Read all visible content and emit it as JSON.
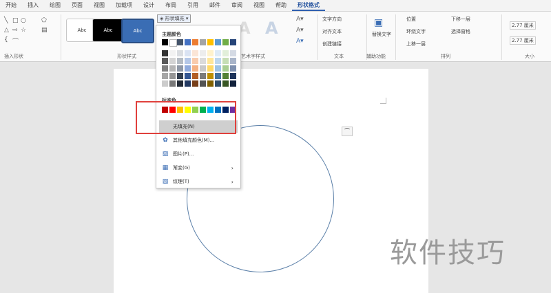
{
  "tabs": [
    "开始",
    "插入",
    "绘图",
    "页面",
    "视图",
    "加载项",
    "设计",
    "布局",
    "引用",
    "邮件",
    "审阅",
    "视图",
    "帮助",
    "形状格式"
  ],
  "active_tab": "形状格式",
  "ribbon": {
    "groups": [
      "插入形状",
      "形状样式",
      "艺术字样式",
      "文本",
      "辅助功能",
      "排列",
      "大小"
    ],
    "style_labels": [
      "Abc",
      "Abc",
      "Abc"
    ],
    "fill_button": "形状填充",
    "text_buttons": [
      "文字方向",
      "对齐文本",
      "创建链接"
    ],
    "alt_text": "替换文字",
    "arrange_buttons": [
      "位置",
      "环绕文字",
      "上移一层",
      "下移一层",
      "选择窗格"
    ],
    "size": {
      "height": "2.77 厘米",
      "width": "2.77 厘米"
    }
  },
  "menu": {
    "theme_colors_label": "主题颜色",
    "standard_colors_label": "标准色",
    "items": [
      {
        "label": "无填充(N)",
        "icon": "no-fill-icon",
        "has_arrow": false
      },
      {
        "label": "其他填充颜色(M)...",
        "icon": "palette-icon",
        "has_arrow": false
      },
      {
        "label": "图片(P)...",
        "icon": "picture-icon",
        "has_arrow": false
      },
      {
        "label": "渐变(G)",
        "icon": "gradient-icon",
        "has_arrow": true
      },
      {
        "label": "纹理(T)",
        "icon": "texture-icon",
        "has_arrow": true
      }
    ],
    "theme_top": [
      "#000000",
      "#ffffff",
      "#44546a",
      "#4472c4",
      "#ed7d31",
      "#a5a5a5",
      "#ffc000",
      "#5b9bd5",
      "#70ad47",
      "#264478"
    ],
    "standard": [
      "#c00000",
      "#ff0000",
      "#ffc000",
      "#ffff00",
      "#92d050",
      "#00b050",
      "#00b0f0",
      "#0070c0",
      "#002060",
      "#7030a0"
    ]
  },
  "watermark": "软件技巧",
  "colors": {
    "highlight": "#e0403c",
    "active_tab": "#1f4e9c",
    "circle_stroke": "#5a7fa8"
  }
}
